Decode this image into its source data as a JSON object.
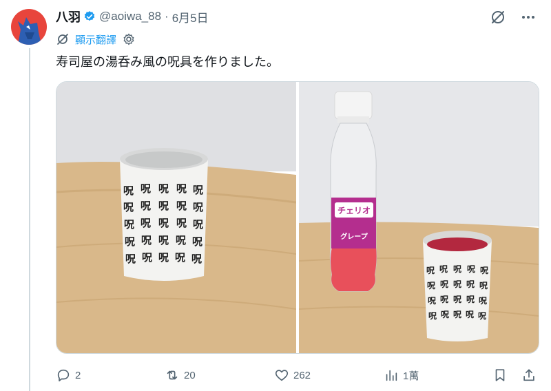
{
  "post": {
    "display_name": "八羽",
    "handle": "@aoiwa_88",
    "separator": "·",
    "date": "6月5日",
    "translate_label": "顯示翻譯",
    "text": "寿司屋の湯呑み風の呪具を作りました。"
  },
  "media": {
    "cup_glyph": "呪",
    "bottle_brand": "チェリオ",
    "bottle_flavor": "グレープ"
  },
  "actions": {
    "replies": "2",
    "reposts": "20",
    "likes": "262",
    "views": "1萬"
  },
  "icons": {
    "verified": "verified-badge-icon",
    "grok": "grok-icon",
    "more": "more-icon",
    "translate": "translate-icon",
    "settings": "gear-icon",
    "reply": "reply-icon",
    "repost": "repost-icon",
    "like": "heart-icon",
    "views": "views-icon",
    "bookmark": "bookmark-icon",
    "share": "share-icon"
  },
  "colors": {
    "accent": "#1d9bf0",
    "secondary_text": "#536471"
  }
}
